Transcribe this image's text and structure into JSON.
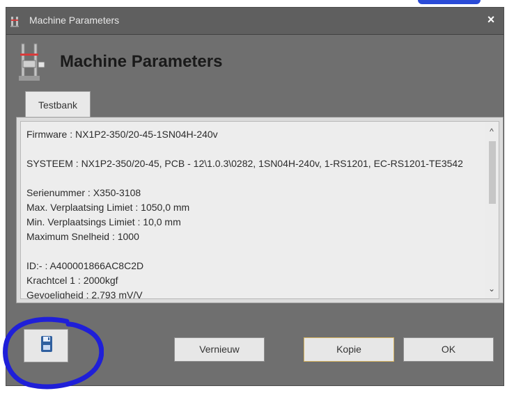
{
  "window": {
    "title": "Machine Parameters",
    "close_label": "×"
  },
  "header": {
    "title": "Machine Parameters",
    "icon": "testing-machine-icon"
  },
  "tabs": [
    {
      "label": "Testbank",
      "active": true
    }
  ],
  "content": {
    "lines": [
      "Firmware : NX1P2-350/20-45-1SN04H-240v",
      "",
      "SYSTEEM : NX1P2-350/20-45, PCB - 12\\1.0.3\\0282, 1SN04H-240v,  1-RS1201,  EC-RS1201-TE3542",
      "",
      "Serienummer : X350-3108",
      "Max. Verplaatsing Limiet : 1050,0 mm",
      "Min. Verplaatsings Limiet : 10,0 mm",
      "Maximum Snelheid : 1000",
      "",
      "ID:- : A400001866AC8C2D",
      "Krachtcel 1 : 2000kgf",
      "Gevoeligheid : 2,793 mV/V"
    ]
  },
  "scrollbar": {
    "up_icon": "chevron-up-icon",
    "down_icon": "chevron-down-icon",
    "up_label": "^",
    "down_label": "⌄"
  },
  "buttons": {
    "save_icon": "floppy-disk-icon",
    "vernieuw": "Vernieuw",
    "kopie": "Kopie",
    "ok": "OK"
  },
  "colors": {
    "window_bg": "#6f6f6f",
    "titlebar": "#5f5f5f",
    "panel": "#dcdcdc",
    "button_bg": "#e7e7e7",
    "kopie_border": "#d6b35f",
    "annotation": "#1f1fd8",
    "save_icon": "#2f5f9f"
  }
}
